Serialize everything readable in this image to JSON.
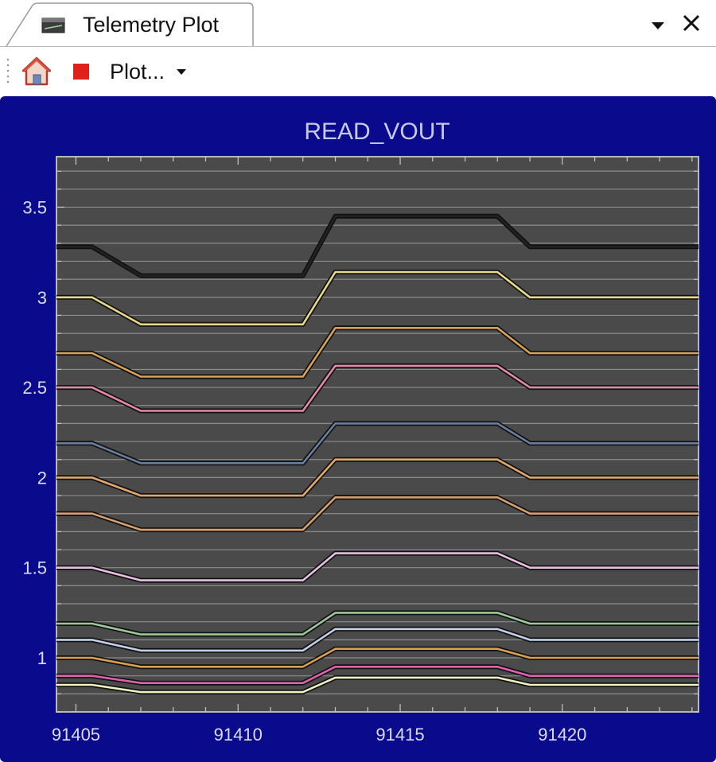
{
  "tab": {
    "title": "Telemetry Plot",
    "icon": "plot-window-icon"
  },
  "window_controls": {
    "menu_icon": "chevron-down-icon",
    "close_icon": "close-icon"
  },
  "toolbar": {
    "home_icon": "home-icon",
    "stop_icon": "stop-icon",
    "plot_menu_label": "Plot...",
    "plot_menu_icon": "chevron-down-icon"
  },
  "colors": {
    "plot_background": "#0a0a8c",
    "axes_background": "#4a4a4a",
    "gridline": "#8c8c8c",
    "text": "#dcdcf0"
  },
  "chart_data": {
    "type": "line",
    "title": "READ_VOUT",
    "xlabel": "",
    "ylabel": "",
    "xlim": [
      91404.4,
      91424.2
    ],
    "ylim": [
      0.7,
      3.78
    ],
    "x_ticks": [
      91405,
      91410,
      91415,
      91420
    ],
    "y_ticks": [
      1,
      1.5,
      2,
      2.5,
      3,
      3.5
    ],
    "grid": true,
    "legend": "none",
    "x": [
      91404.4,
      91405.5,
      91407.0,
      91412.0,
      91413.0,
      91418.0,
      91419.0,
      91424.2
    ],
    "series": [
      {
        "color": "#222222",
        "values": [
          3.28,
          3.28,
          3.12,
          3.12,
          3.45,
          3.45,
          3.28,
          3.28
        ]
      },
      {
        "color": "#e8d98a",
        "values": [
          3.0,
          3.0,
          2.85,
          2.85,
          3.14,
          3.14,
          3.0,
          3.0
        ]
      },
      {
        "color": "#d9a25a",
        "values": [
          2.69,
          2.69,
          2.56,
          2.56,
          2.83,
          2.83,
          2.69,
          2.69
        ]
      },
      {
        "color": "#e48aa8",
        "values": [
          2.5,
          2.5,
          2.37,
          2.37,
          2.62,
          2.62,
          2.5,
          2.5
        ]
      },
      {
        "color": "#6a7fa0",
        "values": [
          2.19,
          2.19,
          2.08,
          2.08,
          2.3,
          2.3,
          2.19,
          2.19
        ]
      },
      {
        "color": "#e0a86a",
        "values": [
          2.0,
          2.0,
          1.9,
          1.9,
          2.1,
          2.1,
          2.0,
          2.0
        ]
      },
      {
        "color": "#d8a070",
        "values": [
          1.8,
          1.8,
          1.71,
          1.71,
          1.89,
          1.89,
          1.8,
          1.8
        ]
      },
      {
        "color": "#e8c0e0",
        "values": [
          1.5,
          1.5,
          1.43,
          1.43,
          1.58,
          1.58,
          1.5,
          1.5
        ]
      },
      {
        "color": "#9ec89a",
        "values": [
          1.19,
          1.19,
          1.13,
          1.13,
          1.25,
          1.25,
          1.19,
          1.19
        ]
      },
      {
        "color": "#c0d0e8",
        "values": [
          1.1,
          1.1,
          1.04,
          1.04,
          1.16,
          1.16,
          1.1,
          1.1
        ]
      },
      {
        "color": "#d8a050",
        "values": [
          1.0,
          1.0,
          0.95,
          0.95,
          1.05,
          1.05,
          1.0,
          1.0
        ]
      },
      {
        "color": "#e060b0",
        "values": [
          0.9,
          0.9,
          0.86,
          0.86,
          0.95,
          0.95,
          0.9,
          0.9
        ]
      },
      {
        "color": "#f0f0c0",
        "values": [
          0.85,
          0.85,
          0.81,
          0.81,
          0.89,
          0.89,
          0.85,
          0.85
        ]
      }
    ]
  }
}
